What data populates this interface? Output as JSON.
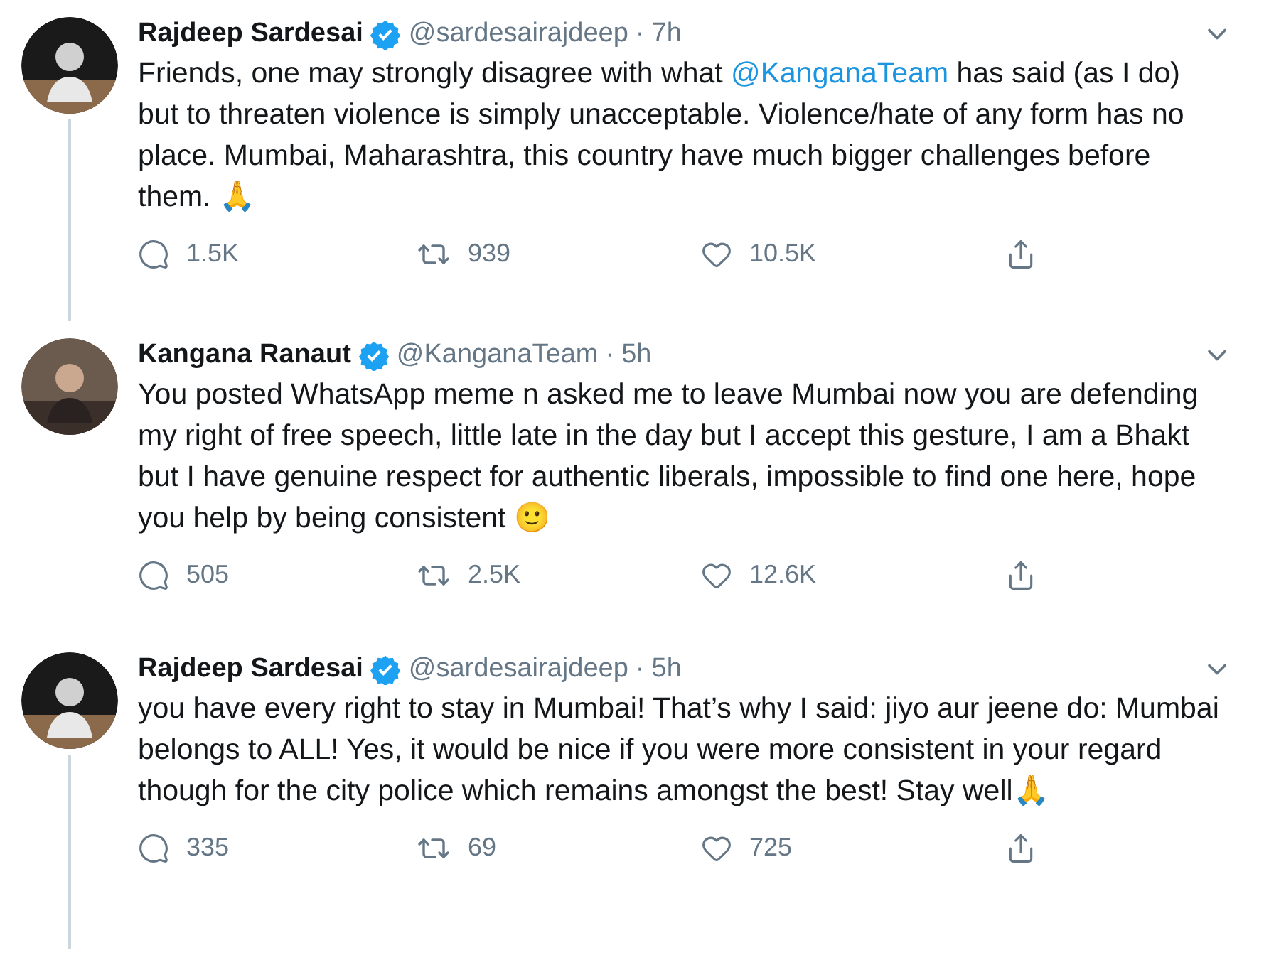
{
  "tweets": [
    {
      "name": "Rajdeep Sardesai",
      "verified": true,
      "handle": "@sardesairajdeep",
      "dot": "·",
      "time": "7h",
      "thread_line": true,
      "body": [
        {
          "kind": "text",
          "text": "Friends, one may strongly disagree with what "
        },
        {
          "kind": "mention",
          "text": "@KanganaTeam"
        },
        {
          "kind": "text",
          "text": " has said (as I do) but to threaten violence is simply unacceptable. Violence/hate of any form has no place. Mumbai, Maharashtra, this country have much bigger challenges before them. 🙏"
        }
      ],
      "replies": "1.5K",
      "retweets": "939",
      "likes": "10.5K"
    },
    {
      "name": "Kangana Ranaut",
      "verified": true,
      "handle": "@KanganaTeam",
      "dot": "·",
      "time": "5h",
      "thread_line": false,
      "body": [
        {
          "kind": "text",
          "text": "You posted WhatsApp meme n asked me to leave Mumbai now you are defending my right of free speech, little late in the day but I accept this gesture, I am a Bhakt but I have genuine respect for authentic liberals, impossible to find one here, hope you help by being consistent 🙂"
        }
      ],
      "replies": "505",
      "retweets": "2.5K",
      "likes": "12.6K"
    },
    {
      "name": "Rajdeep Sardesai",
      "verified": true,
      "handle": "@sardesairajdeep",
      "dot": "·",
      "time": "5h",
      "thread_line": true,
      "body": [
        {
          "kind": "text",
          "text": "you have every right to stay in Mumbai! That’s why I said: jiyo aur jeene do: Mumbai belongs to ALL! Yes, it would be nice if you were more consistent in your regard though for the city police which remains amongst the best! Stay well🙏"
        }
      ],
      "replies": "335",
      "retweets": "69",
      "likes": "725"
    }
  ]
}
